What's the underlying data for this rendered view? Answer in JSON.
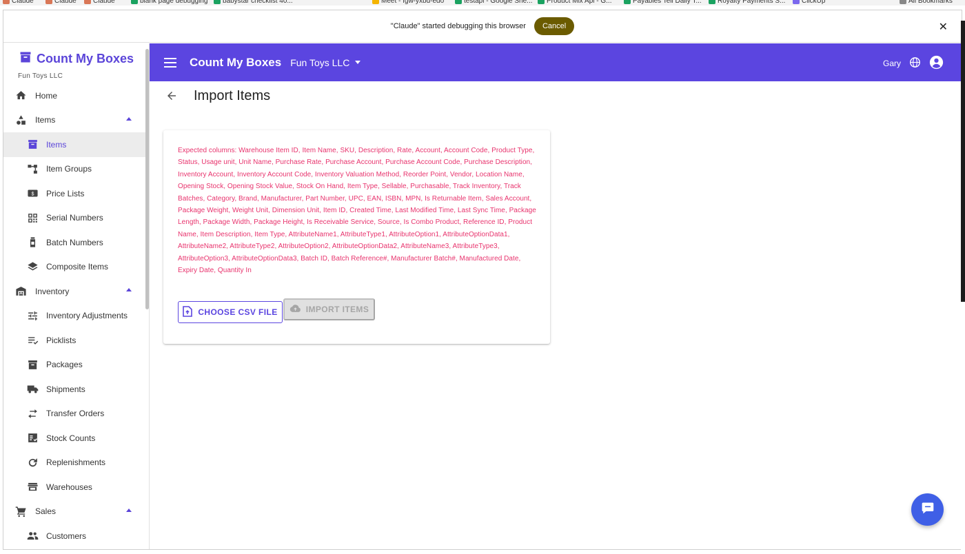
{
  "bookmarks": [
    {
      "label": "Claude",
      "color": "#d97757"
    },
    {
      "label": "Claude",
      "color": "#d97757"
    },
    {
      "label": "Claude",
      "color": "#d97757"
    },
    {
      "label": "blank page debugging",
      "color": "#1aa260"
    },
    {
      "label": "babystar checklist 40...",
      "color": "#1aa260"
    },
    {
      "label": "Meet - fgw-yxbd-edo",
      "color": "#f4b400"
    },
    {
      "label": "testapi - Google She...",
      "color": "#1aa260"
    },
    {
      "label": "Product Mix Api - G...",
      "color": "#1aa260"
    },
    {
      "label": "Payables Tell Daily T...",
      "color": "#1aa260"
    },
    {
      "label": "Royalty Payments S...",
      "color": "#1aa260"
    },
    {
      "label": "ClickUp",
      "color": "#7b68ee"
    },
    {
      "label": "All Bookmarks",
      "color": "#888888"
    }
  ],
  "debug_bar": {
    "message": "\"Claude\" started debugging this browser",
    "cancel_label": "Cancel"
  },
  "sidebar": {
    "brand_name": "Count My Boxes",
    "company_name": "Fun Toys LLC",
    "items": [
      {
        "label": "Home",
        "icon": "home-icon",
        "level": "top"
      },
      {
        "label": "Items",
        "icon": "shapes-icon",
        "level": "top",
        "expanded": true
      },
      {
        "label": "Items",
        "icon": "archive-box-icon",
        "level": "sub",
        "active": true
      },
      {
        "label": "Item Groups",
        "icon": "hierarchy-icon",
        "level": "sub"
      },
      {
        "label": "Price Lists",
        "icon": "price-tag-icon",
        "level": "sub"
      },
      {
        "label": "Serial Numbers",
        "icon": "qr-code-icon",
        "level": "sub"
      },
      {
        "label": "Batch Numbers",
        "icon": "bottle-icon",
        "level": "sub"
      },
      {
        "label": "Composite Items",
        "icon": "layers-icon",
        "level": "sub"
      },
      {
        "label": "Inventory",
        "icon": "warehouse-icon",
        "level": "top",
        "expanded": true
      },
      {
        "label": "Inventory Adjustments",
        "icon": "tune-icon",
        "level": "sub"
      },
      {
        "label": "Picklists",
        "icon": "checklist-icon",
        "level": "sub"
      },
      {
        "label": "Packages",
        "icon": "archive-box-icon",
        "level": "sub"
      },
      {
        "label": "Shipments",
        "icon": "truck-icon",
        "level": "sub"
      },
      {
        "label": "Transfer Orders",
        "icon": "swap-arrows-icon",
        "level": "sub"
      },
      {
        "label": "Stock Counts",
        "icon": "checkbox-list-icon",
        "level": "sub"
      },
      {
        "label": "Replenishments",
        "icon": "refresh-icon",
        "level": "sub"
      },
      {
        "label": "Warehouses",
        "icon": "store-icon",
        "level": "sub"
      },
      {
        "label": "Sales",
        "icon": "cart-icon",
        "level": "top",
        "expanded": true
      },
      {
        "label": "Customers",
        "icon": "people-icon",
        "level": "sub"
      }
    ]
  },
  "appbar": {
    "title": "Count My Boxes",
    "company": "Fun Toys LLC",
    "user": "Gary"
  },
  "page": {
    "title": "Import Items",
    "expected_columns": "Expected columns: Warehouse Item ID, Item Name, SKU, Description, Rate, Account, Account Code, Product Type, Status, Usage unit, Unit Name, Purchase Rate, Purchase Account, Purchase Account Code, Purchase Description, Inventory Account, Inventory Account Code, Inventory Valuation Method, Reorder Point, Vendor, Location Name, Opening Stock, Opening Stock Value, Stock On Hand, Item Type, Sellable, Purchasable, Track Inventory, Track Batches, Category, Brand, Manufacturer, Part Number, UPC, EAN, ISBN, MPN, Is Returnable Item, Sales Account, Package Weight, Weight Unit, Dimension Unit, Item ID, Created Time, Last Modified Time, Last Sync Time, Package Length, Package Width, Package Height, Is Receivable Service, Source, Is Combo Product, Reference ID, Product Name, Item Description, Item Type, AttributeName1, AttributeType1, AttributeOption1, AttributeOptionData1, AttributeName2, AttributeType2, AttributeOption2, AttributeOptionData2, AttributeName3, AttributeType3, AttributeOption3, AttributeOptionData3, Batch ID, Batch Reference#, Manufacturer Batch#, Manufactured Date, Expiry Date, Quantity In",
    "choose_button": "CHOOSE CSV FILE",
    "import_button": "IMPORT ITEMS"
  },
  "colors": {
    "primary": "#5b45e0",
    "error_text": "#e8336d",
    "fab": "#3f5fe6"
  }
}
